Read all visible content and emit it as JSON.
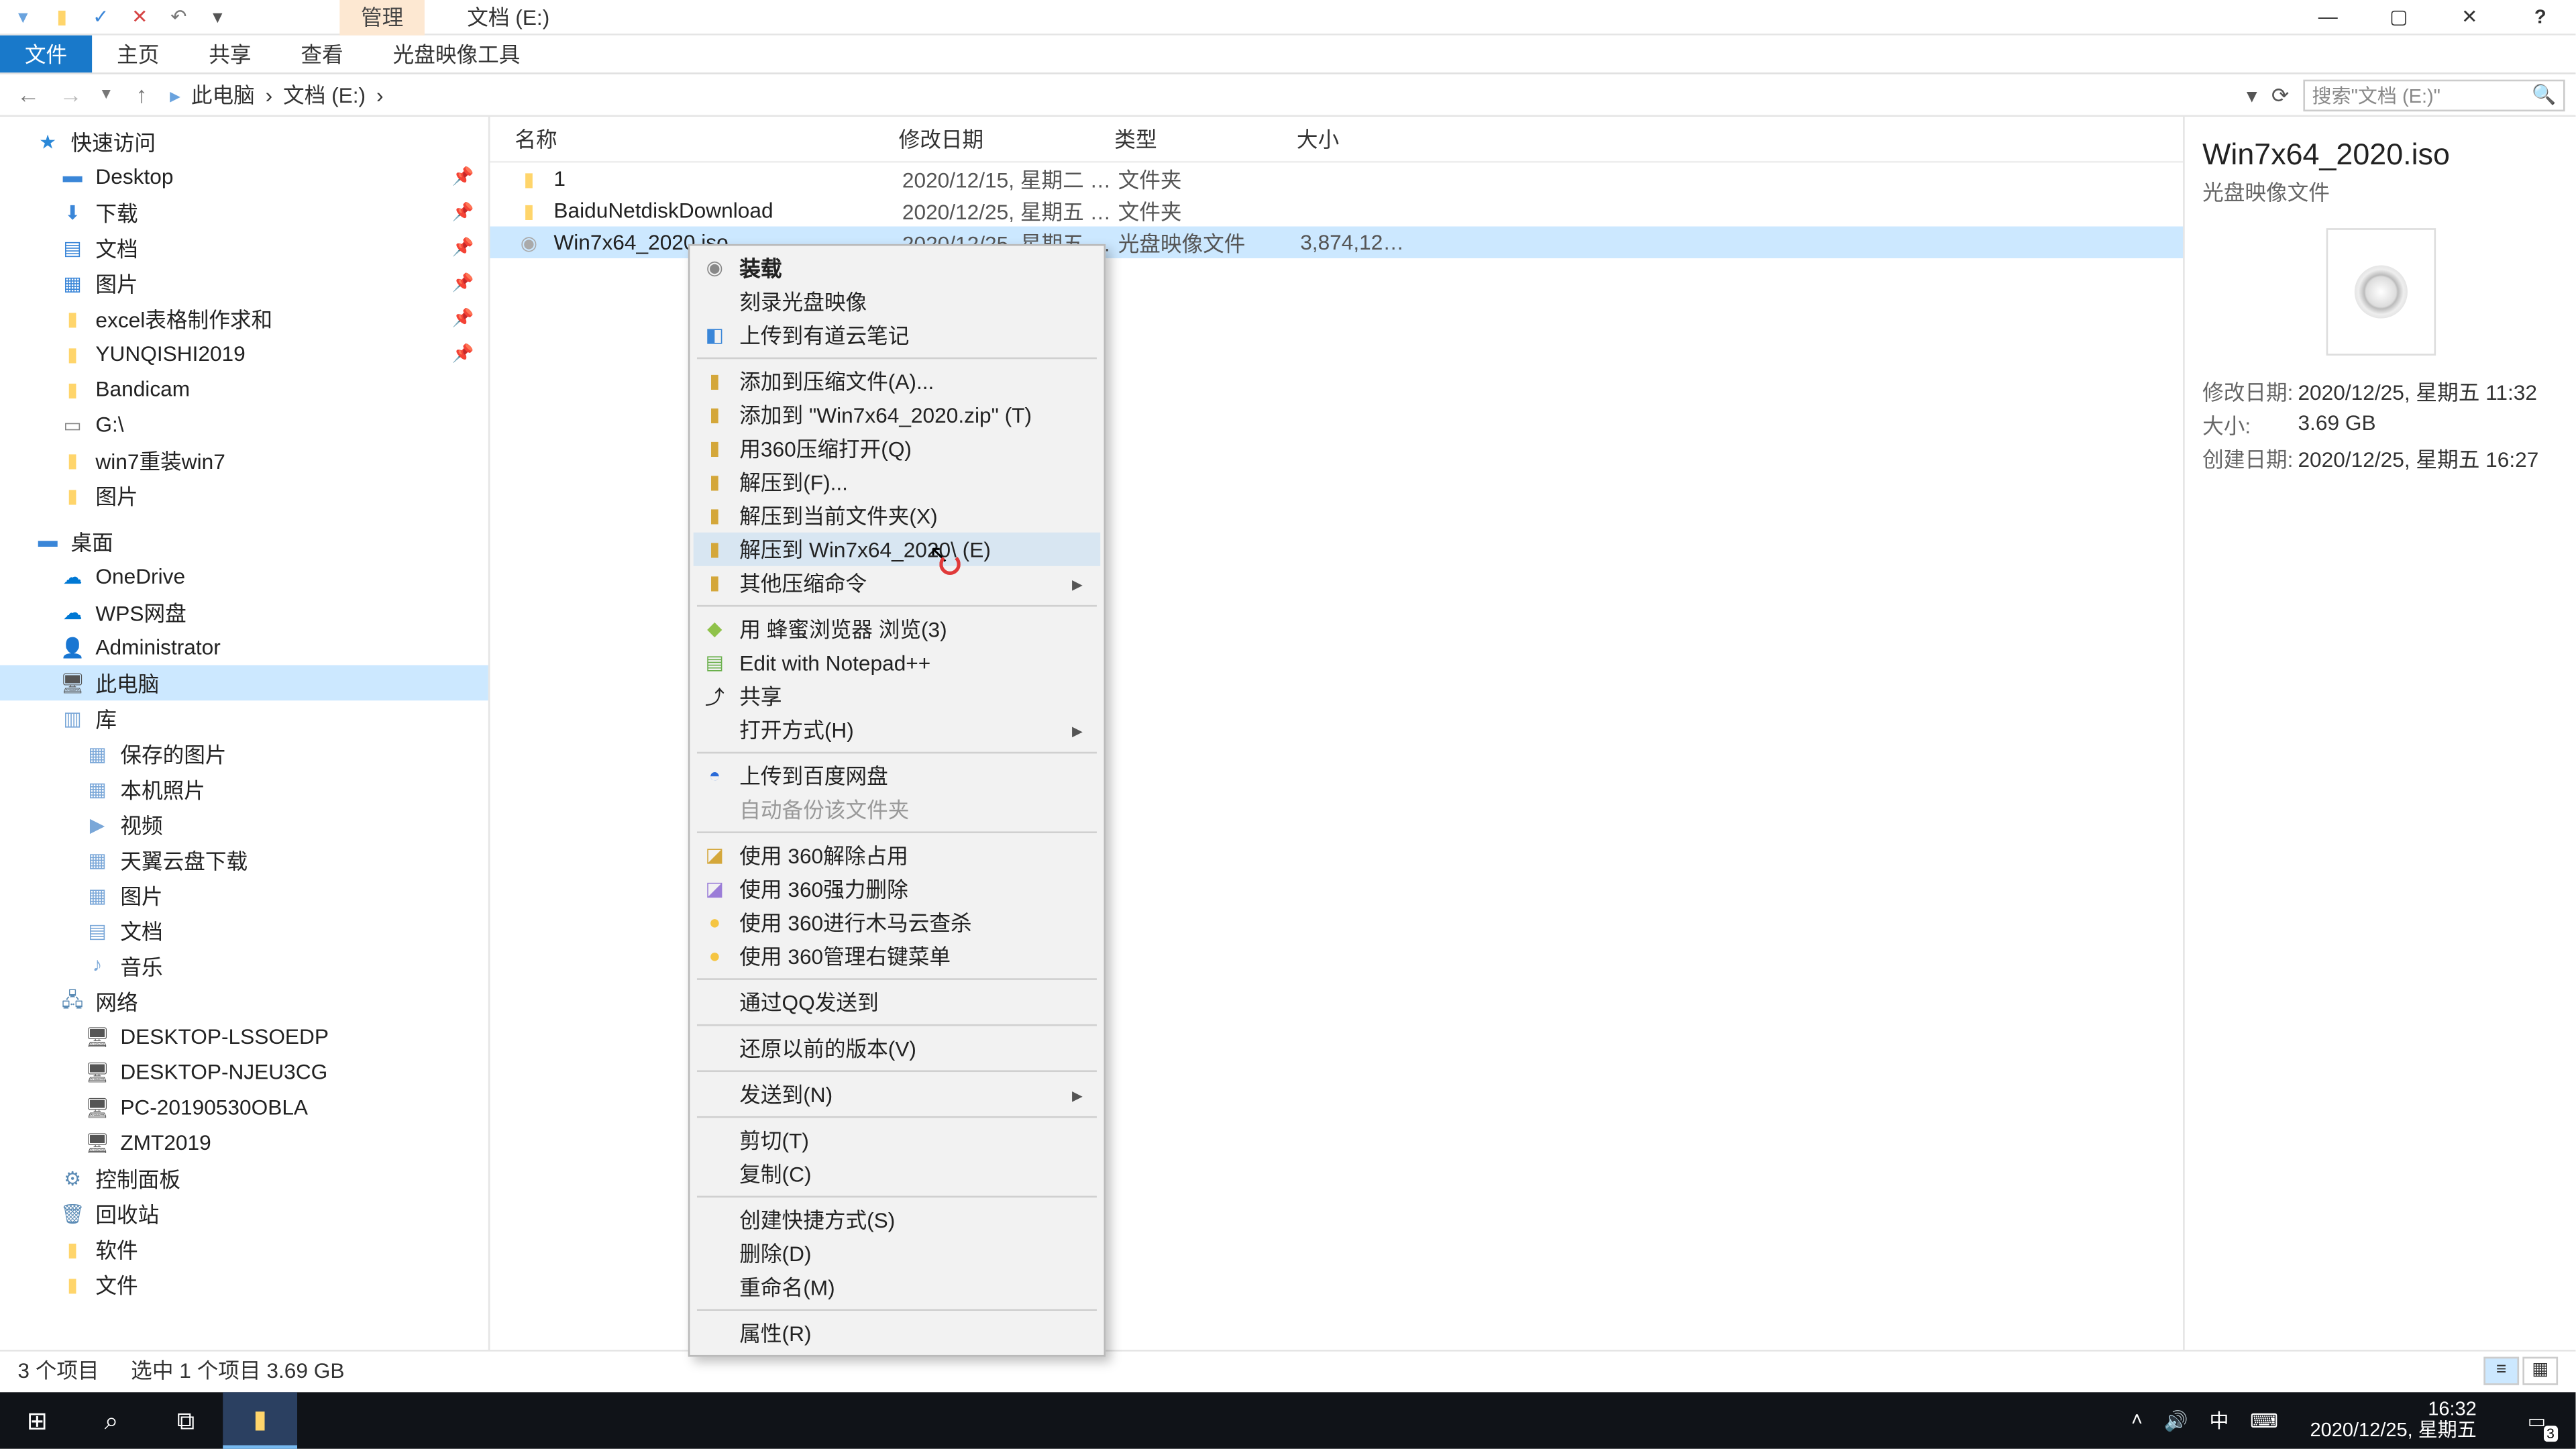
{
  "title": "文档 (E:)",
  "ribbon_tab_manage": "管理",
  "ribbon": {
    "file": "文件",
    "home": "主页",
    "share": "共享",
    "view": "查看",
    "disc": "光盘映像工具"
  },
  "breadcrumb": {
    "pc": "此电脑",
    "doc": "文档 (E:)"
  },
  "search_placeholder": "搜索\"文档 (E:)\"",
  "columns": {
    "name": "名称",
    "date": "修改日期",
    "type": "类型",
    "size": "大小"
  },
  "nav": {
    "quick": "快速访问",
    "items_quick": [
      "Desktop",
      "下载",
      "文档",
      "图片",
      "excel表格制作求和",
      "YUNQISHI2019",
      "Bandicam",
      "G:\\",
      "win7重装win7",
      "图片"
    ],
    "desktop": "桌面",
    "onedrive": "OneDrive",
    "wps": "WPS网盘",
    "admin": "Administrator",
    "pc": "此电脑",
    "lib": "库",
    "lib_items": [
      "保存的图片",
      "本机照片",
      "视频",
      "天翼云盘下载",
      "图片",
      "文档",
      "音乐"
    ],
    "net": "网络",
    "net_items": [
      "DESKTOP-LSSOEDP",
      "DESKTOP-NJEU3CG",
      "PC-20190530OBLA",
      "ZMT2019"
    ],
    "panel": "控制面板",
    "bin": "回收站",
    "soft": "软件",
    "docs": "文件"
  },
  "files": [
    {
      "name": "1",
      "date": "2020/12/15, 星期二 1...",
      "type": "文件夹",
      "size": ""
    },
    {
      "name": "BaiduNetdiskDownload",
      "date": "2020/12/25, 星期五 1...",
      "type": "文件夹",
      "size": ""
    },
    {
      "name": "Win7x64_2020.iso",
      "date": "2020/12/25, 星期五 1...",
      "type": "光盘映像文件",
      "size": "3,874,126..."
    }
  ],
  "cm": {
    "mount": "装载",
    "burn": "刻录光盘映像",
    "youdao": "上传到有道云笔记",
    "addzip": "添加到压缩文件(A)...",
    "addnamed": "添加到 \"Win7x64_2020.zip\" (T)",
    "open360": "用360压缩打开(Q)",
    "extractto": "解压到(F)...",
    "extracthere": "解压到当前文件夹(X)",
    "extractnamed": "解压到 Win7x64_2020\\ (E)",
    "othercomp": "其他压缩命令",
    "beebrowser": "用 蜂蜜浏览器 浏览(3)",
    "notepad": "Edit with Notepad++",
    "share": "共享",
    "openwith": "打开方式(H)",
    "baidu": "上传到百度网盘",
    "autobak": "自动备份该文件夹",
    "unlock360": "使用 360解除占用",
    "forcedel360": "使用 360强力删除",
    "scan360": "使用 360进行木马云查杀",
    "mgr360": "使用 360管理右键菜单",
    "qqsend": "通过QQ发送到",
    "restore": "还原以前的版本(V)",
    "sendto": "发送到(N)",
    "cut": "剪切(T)",
    "copy": "复制(C)",
    "shortcut": "创建快捷方式(S)",
    "del": "删除(D)",
    "rename": "重命名(M)",
    "props": "属性(R)"
  },
  "preview": {
    "title": "Win7x64_2020.iso",
    "sub": "光盘映像文件",
    "mod_k": "修改日期:",
    "mod_v": "2020/12/25, 星期五 11:32",
    "size_k": "大小:",
    "size_v": "3.69 GB",
    "create_k": "创建日期:",
    "create_v": "2020/12/25, 星期五 16:27"
  },
  "status": {
    "count": "3 个项目",
    "sel": "选中 1 个项目  3.69 GB"
  },
  "tray": {
    "ime": "中",
    "time": "16:32",
    "date": "2020/12/25, 星期五",
    "badge": "3"
  }
}
